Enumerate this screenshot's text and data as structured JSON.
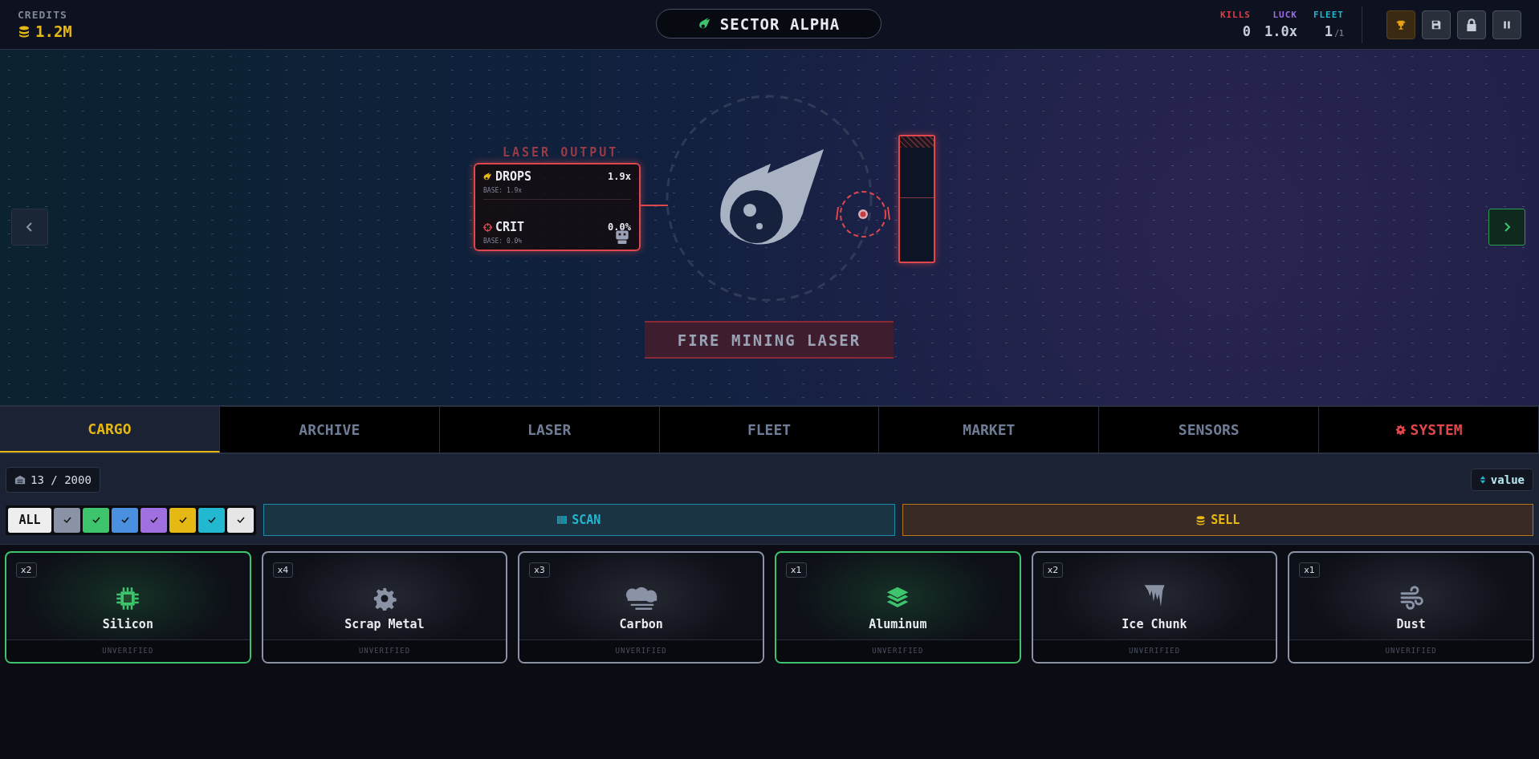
{
  "top_bar": {
    "credits_label": "CREDITS",
    "credits_value": "1.2M",
    "sector": "SECTOR ALPHA",
    "stats": [
      {
        "label": "KILLS",
        "value": "0",
        "color": "#d9404a"
      },
      {
        "label": "LUCK",
        "value": "1.0x",
        "color": "#9a6ee0"
      },
      {
        "label": "FLEET",
        "value": "1",
        "suffix": "/1",
        "color": "#22b8cf"
      }
    ],
    "buttons": [
      {
        "kind": "trophy"
      },
      {
        "kind": "save"
      },
      {
        "kind": "lock"
      },
      {
        "kind": "pause"
      }
    ]
  },
  "laser_output": {
    "title": "LASER OUTPUT",
    "rows": [
      {
        "kind": "drops",
        "label": "DROPS",
        "value": "1.9x",
        "base": "BASE: 1.9x"
      },
      {
        "kind": "crit",
        "label": "CRIT",
        "value": "0.0%",
        "base": "BASE: 0.0%"
      }
    ]
  },
  "fire_button": "FIRE MINING LASER",
  "tabs": [
    {
      "label": "CARGO",
      "selected": true,
      "kind": "plain"
    },
    {
      "label": "ARCHIVE",
      "selected": false,
      "kind": "plain"
    },
    {
      "label": "LASER",
      "selected": false,
      "kind": "plain"
    },
    {
      "label": "FLEET",
      "selected": false,
      "kind": "plain"
    },
    {
      "label": "MARKET",
      "selected": false,
      "kind": "plain"
    },
    {
      "label": "SENSORS",
      "selected": false,
      "kind": "plain"
    },
    {
      "label": "SYSTEM",
      "selected": false,
      "kind": "system"
    }
  ],
  "storage": "13 / 2000",
  "sort": "value",
  "filters": {
    "all": "ALL",
    "chips": [
      {
        "color": "#8a93a6",
        "checked": true
      },
      {
        "color": "#3ec46d",
        "checked": true
      },
      {
        "color": "#4a8fe0",
        "checked": true
      },
      {
        "color": "#a070e0",
        "checked": true
      },
      {
        "color": "#e5b814",
        "checked": true
      },
      {
        "color": "#22b8cf",
        "checked": true
      },
      {
        "color": "#e6e6e6",
        "checked": true
      }
    ]
  },
  "scan": "SCAN",
  "sell": "SELL",
  "items": [
    {
      "name": "Silicon",
      "count": "x2",
      "status": "UNVERIFIED",
      "kind": "chip",
      "color": "#3ec46d"
    },
    {
      "name": "Scrap Metal",
      "count": "x4",
      "status": "UNVERIFIED",
      "kind": "gear",
      "color": "#8a93a6"
    },
    {
      "name": "Carbon",
      "count": "x3",
      "status": "UNVERIFIED",
      "kind": "cloud",
      "color": "#8a93a6"
    },
    {
      "name": "Aluminum",
      "count": "x1",
      "status": "UNVERIFIED",
      "kind": "layers",
      "color": "#3ec46d"
    },
    {
      "name": "Ice Chunk",
      "count": "x2",
      "status": "UNVERIFIED",
      "kind": "icicle",
      "color": "#8a93a6"
    },
    {
      "name": "Dust",
      "count": "x1",
      "status": "UNVERIFIED",
      "kind": "wind",
      "color": "#8a93a6"
    }
  ]
}
